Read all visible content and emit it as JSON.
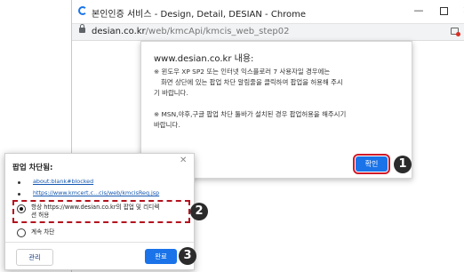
{
  "window": {
    "title": "본인인증 서비스 - Design, Detail, DESIAN - Chrome",
    "minimize": "—",
    "close": "✕"
  },
  "address": {
    "host": "desian.co.kr",
    "path": "/web/kmcApi/kmcis_web_step02"
  },
  "alert": {
    "title": "www.desian.co.kr 내용:",
    "line1": "※ 윈도우 XP SP2 또는 인터넷 익스플로러 7 사용자일 경우에는",
    "line2": "화면 상단에 있는 팝업 차단 알림줄을 클릭하여 팝업을 허용해 주시",
    "line3": "기 바랍니다.",
    "line4": "※ MSN,야후,구글 팝업 차단 툴바가 설치된 경우 팝업허용을 해주시기",
    "line5": "바랍니다.",
    "ok": "확인"
  },
  "markers": [
    "1",
    "2",
    "3"
  ],
  "popup": {
    "title": "팝업 차단됨:",
    "close": "✕",
    "links": [
      "about:blank#blocked",
      "https://www.kmcert.c...cis/web/kmcisReq.jsp"
    ],
    "option_allow_line1": "항상 https://www.desian.co.kr의 팝업 및 리디렉",
    "option_allow_line2": "션 허용",
    "option_block": "계속 차단",
    "manage": "관리",
    "done": "완료"
  }
}
